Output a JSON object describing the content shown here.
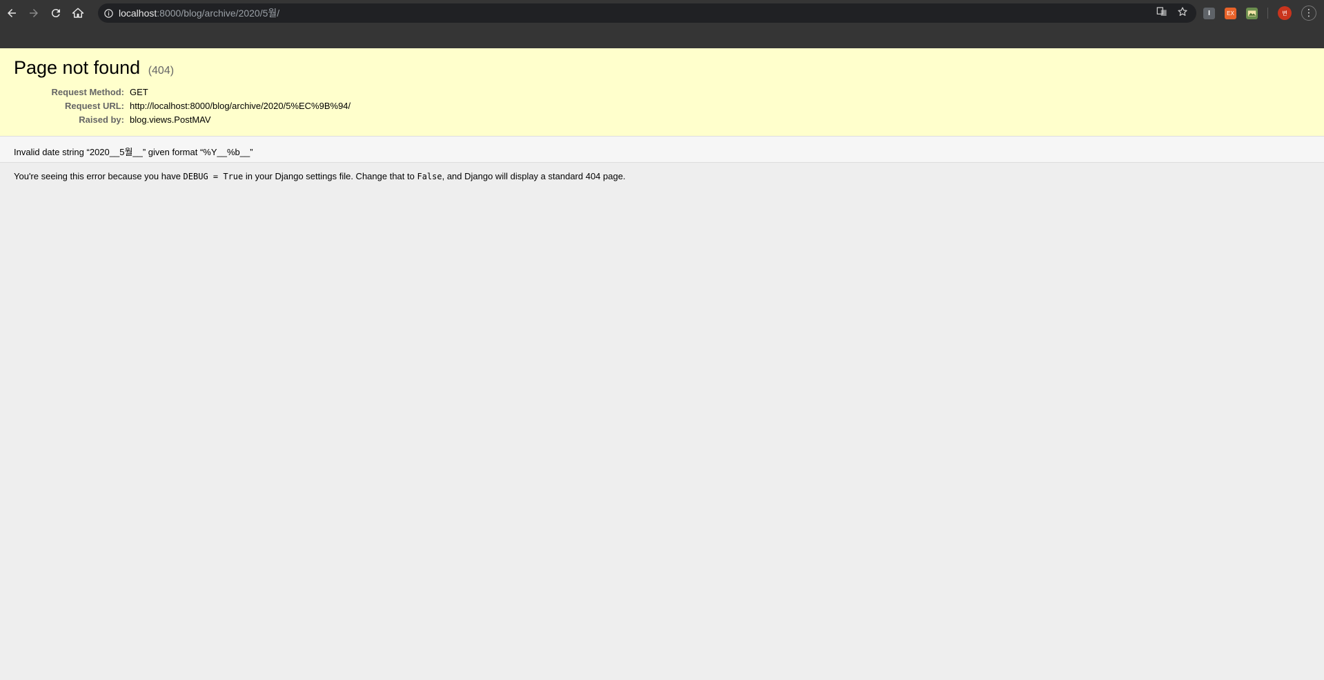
{
  "browser": {
    "url_host": "localhost",
    "url_rest": ":8000/blog/archive/2020/5월/",
    "extensions": [
      "I",
      "EX",
      "img"
    ],
    "profile_initial": "변",
    "icons": [
      "back-icon",
      "forward-icon",
      "reload-icon",
      "home-icon",
      "info-icon",
      "translate-icon",
      "star-icon",
      "menu-icon"
    ]
  },
  "error": {
    "title": "Page not found",
    "code": "(404)",
    "rows": [
      {
        "label": "Request Method:",
        "value": "GET"
      },
      {
        "label": "Request URL:",
        "value": "http://localhost:8000/blog/archive/2020/5%EC%9B%94/"
      },
      {
        "label": "Raised by:",
        "value": "blog.views.PostMAV"
      }
    ],
    "info": "Invalid date string “2020__5월__” given format “%Y__%b__”"
  },
  "explanation": {
    "part1": "You're seeing this error because you have ",
    "code1": "DEBUG = True",
    "part2": " in your Django settings file. Change that to ",
    "code2": "False",
    "part3": ", and Django will display a standard 404 page."
  }
}
